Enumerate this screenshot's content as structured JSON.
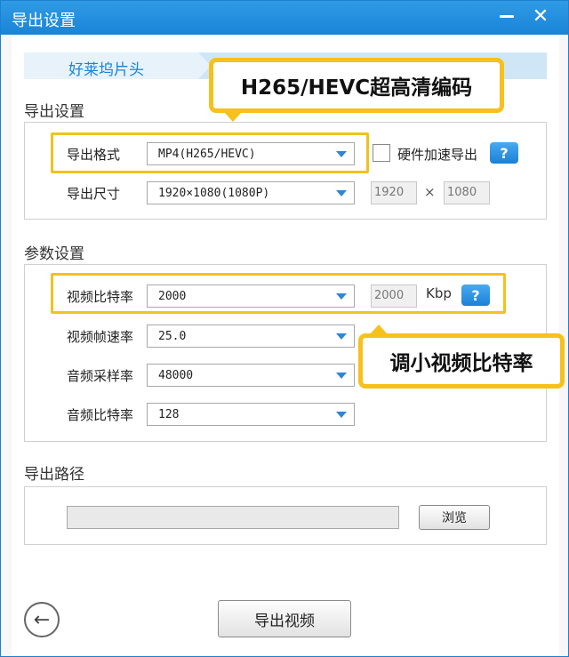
{
  "window": {
    "title": "导出设置",
    "minimize_icon": "minimize-icon",
    "close_icon": "close-icon"
  },
  "steps": {
    "active_label": "好莱坞片头"
  },
  "export_section": {
    "title": "导出设置",
    "format_label": "导出格式",
    "format_value": "MP4(H265/HEVC)",
    "hw_accel_label": "硬件加速导出",
    "hw_accel_checked": false,
    "size_label": "导出尺寸",
    "size_value": "1920×1080(1080P)",
    "width_value": "1920",
    "times_sign": "×",
    "height_value": "1080",
    "help_text": "?"
  },
  "param_section": {
    "title": "参数设置",
    "video_bitrate_label": "视频比特率",
    "video_bitrate_value": "2000",
    "video_bitrate_box": "2000",
    "bitrate_unit": "Kbp",
    "help_text": "?",
    "frame_rate_label": "视频帧速率",
    "frame_rate_value": "25.0",
    "audio_sample_label": "音频采样率",
    "audio_sample_value": "48000",
    "audio_bitrate_label": "音频比特率",
    "audio_bitrate_value": "128"
  },
  "path_section": {
    "title": "导出路径",
    "path_value": "",
    "browse_label": "浏览"
  },
  "footer": {
    "export_label": "导出视频",
    "back_icon": "arrow-left-icon"
  },
  "annotations": {
    "codec_callout": "H265/HEVC超高清编码",
    "bitrate_callout": "调小视频比特率"
  },
  "colors": {
    "accent": "#1a84d6",
    "highlight": "#f6c11a"
  }
}
